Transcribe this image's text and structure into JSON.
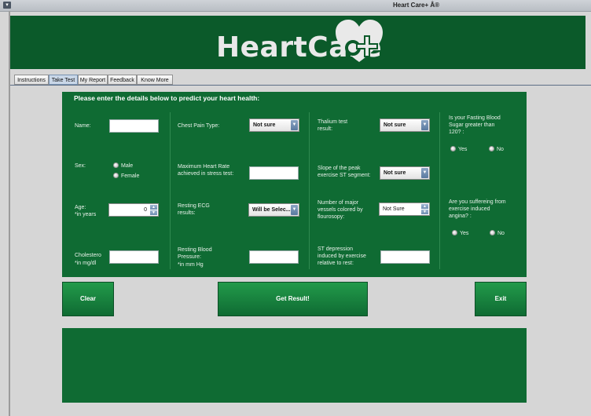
{
  "window": {
    "title": "Heart Care+ Â®",
    "menu_icon": "▾"
  },
  "brand": {
    "name": "HeartCare",
    "logo_icon": "heart-plus-icon",
    "banner_color": "#0b5a2a"
  },
  "tabs": [
    {
      "label": "Instructions"
    },
    {
      "label": "Take Test",
      "active": true
    },
    {
      "label": "My Report"
    },
    {
      "label": "Feedback"
    },
    {
      "label": "Know More"
    }
  ],
  "form": {
    "heading": "Please enter the details below to predict your heart health:",
    "name": {
      "label": "Name:",
      "value": ""
    },
    "sex": {
      "label": "Sex:",
      "options": [
        "Male",
        "Female"
      ]
    },
    "age": {
      "label": "Age:",
      "unit": "*in years",
      "value": "0"
    },
    "cholesterol": {
      "label": "Cholestero",
      "unit": "*in mg/dl",
      "value": ""
    },
    "chest_pain": {
      "label": "Chest Pain Type:",
      "selected": "Not sure"
    },
    "max_heart_rate": {
      "label": "Maximum Heart Rate achieved in stress test:",
      "value": ""
    },
    "resting_ecg": {
      "label": "Resting ECG results:",
      "selected": "Will be Selec..."
    },
    "resting_bp": {
      "label": "Resting Blood Pressure:",
      "unit": "*in mm Hg",
      "value": ""
    },
    "thalium": {
      "label": "Thalium test result:",
      "selected": "Not sure"
    },
    "slope": {
      "label": "Slope of the peak exercise ST segment:",
      "selected": "Not sure"
    },
    "vessels": {
      "label": "Number of major vessels colored by flourosopy:",
      "value": "Not Sure"
    },
    "st_depression": {
      "label": "ST depression induced by exercise relative to rest:",
      "value": ""
    },
    "fasting_sugar": {
      "label": "Is your Fasting Blood Sugar greater than 120? :",
      "options": [
        "Yes",
        "No"
      ]
    },
    "angina": {
      "label": "Are you suffereing from exercise induced angina? :",
      "options": [
        "Yes",
        "No"
      ]
    }
  },
  "buttons": {
    "clear": "Clear",
    "get_result": "Get Result!",
    "exit": "Exit"
  },
  "colors": {
    "panel": "#0f6b33",
    "button": "#1a8a40",
    "background": "#d6d6d6"
  }
}
